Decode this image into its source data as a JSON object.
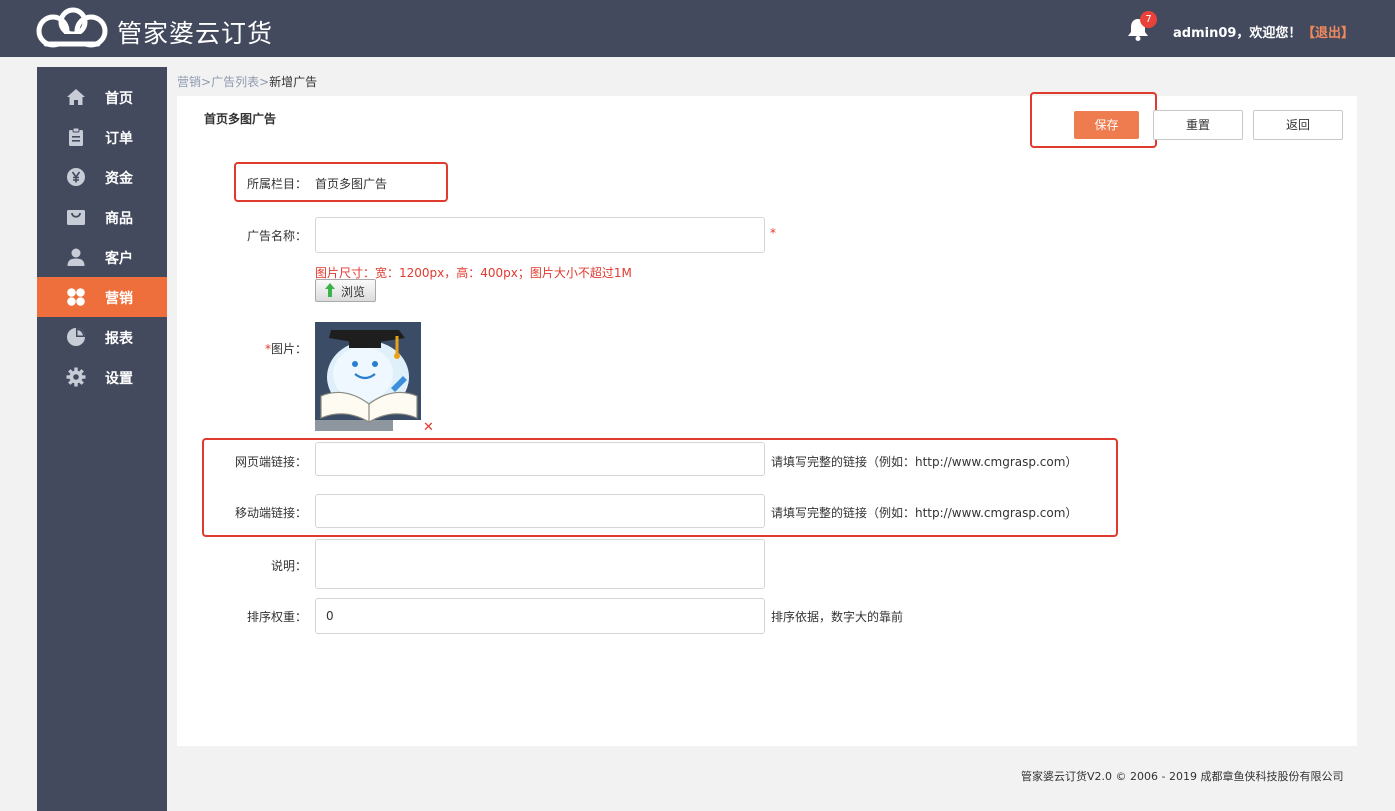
{
  "header": {
    "brand": "管家婆云订货",
    "notification_count": "7",
    "welcome": "admin09，欢迎您！",
    "logout": "【退出】"
  },
  "sidebar": {
    "items": [
      {
        "label": "首页",
        "icon": "home-icon"
      },
      {
        "label": "订单",
        "icon": "clipboard-icon"
      },
      {
        "label": "资金",
        "icon": "yen-icon"
      },
      {
        "label": "商品",
        "icon": "bag-icon"
      },
      {
        "label": "客户",
        "icon": "user-icon"
      },
      {
        "label": "营销",
        "icon": "clover-icon",
        "active": true
      },
      {
        "label": "报表",
        "icon": "pie-chart-icon"
      },
      {
        "label": "设置",
        "icon": "gear-icon"
      }
    ]
  },
  "breadcrumb": {
    "item1": "营销",
    "sep1": ">",
    "item2": "广告列表",
    "sep2": ">",
    "current": "新增广告"
  },
  "panel": {
    "title": "首页多图广告",
    "save": "保存",
    "reset": "重置",
    "back": "返回"
  },
  "form": {
    "column_label": "所属栏目：",
    "column_value": "首页多图广告",
    "name_label": "广告名称：",
    "name_value": "",
    "name_required": "*",
    "size_hint": "图片尺寸：宽：1200px，高：400px；图片大小不超过1M",
    "browse": "浏览",
    "image_required": "*",
    "image_label": "图片：",
    "web_link_label": "网页端链接：",
    "web_link_value": "",
    "web_link_hint": "请填写完整的链接（例如：http://www.cmgrasp.com）",
    "mobile_link_label": "移动端链接：",
    "mobile_link_value": "",
    "mobile_link_hint": "请填写完整的链接（例如：http://www.cmgrasp.com）",
    "desc_label": "说明：",
    "desc_value": "",
    "sort_label": "排序权重：",
    "sort_value": "0",
    "sort_hint": "排序依据，数字大的靠前"
  },
  "footer": "管家婆云订货V2.0 © 2006 - 2019 成都章鱼侠科技股份有限公司",
  "colors": {
    "topbar": "#434a5e",
    "sidebar": "#434a5e",
    "accent": "#ee6f3b",
    "highlight": "#e03a2e"
  }
}
